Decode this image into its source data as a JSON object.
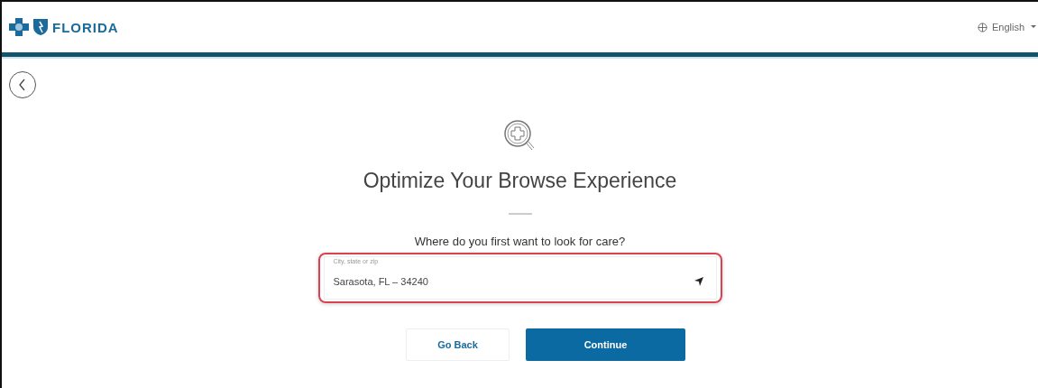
{
  "header": {
    "brand": "FLORIDA",
    "language": "English"
  },
  "title": "Optimize Your Browse Experience",
  "question": "Where do you first want to look for care?",
  "location_field": {
    "label": "City, state or zip",
    "value": "Sarasota, FL – 34240"
  },
  "buttons": [
    {
      "label": "Go Back",
      "kind": "secondary"
    },
    {
      "label": "Continue",
      "kind": "primary"
    }
  ]
}
